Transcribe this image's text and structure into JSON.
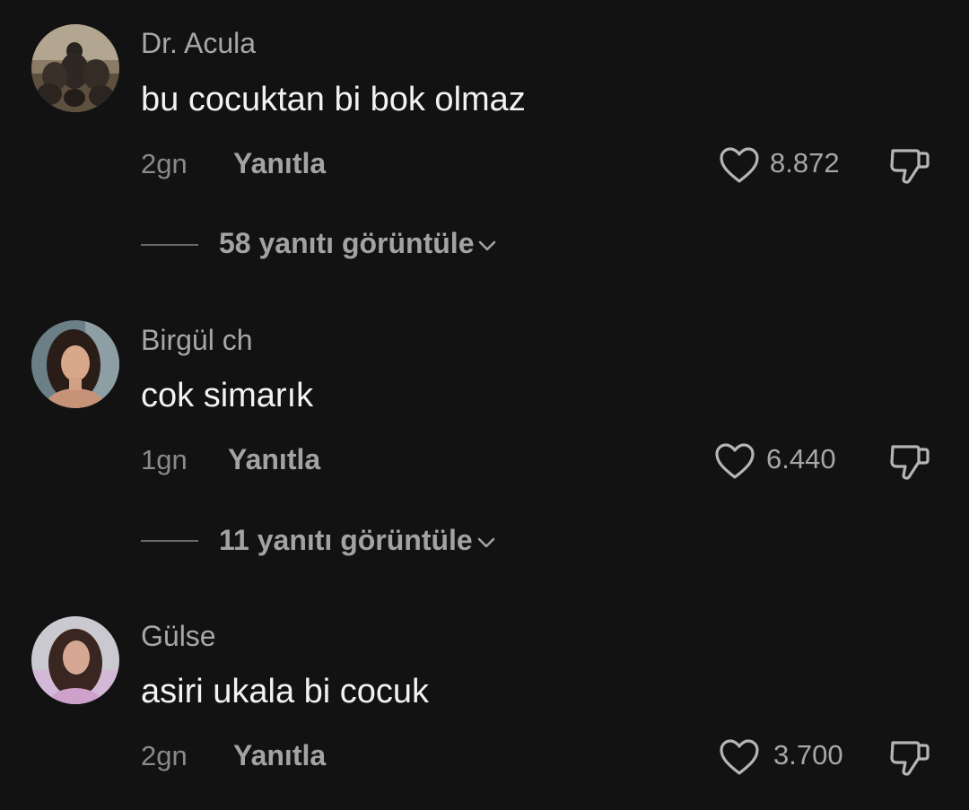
{
  "comments": [
    {
      "username": "Dr. Acula",
      "text": "bu cocuktan bi bok olmaz",
      "time": "2gn",
      "reply_label": "Yanıtla",
      "likes": "8.872",
      "view_replies": "58 yanıtı görüntüle",
      "avatar": "bears-group-avatar"
    },
    {
      "username": "Birgül ch",
      "text": "cok simarık",
      "time": "1gn",
      "reply_label": "Yanıtla",
      "likes": "6.440",
      "view_replies": "11 yanıtı görüntüle",
      "avatar": "woman-portrait-avatar"
    },
    {
      "username": "Gülse",
      "text": "asiri ukala bi cocuk",
      "time": "2gn",
      "reply_label": "Yanıtla",
      "likes": "3.700",
      "avatar": "woman-portrait-avatar"
    }
  ],
  "colors": {
    "background": "#121212",
    "username": "#a7a7a7",
    "comment_text": "#f2f2f2",
    "meta": "#8a8a8a"
  },
  "icons": [
    "heart-outline-icon",
    "thumbs-down-icon",
    "chevron-down-icon"
  ]
}
